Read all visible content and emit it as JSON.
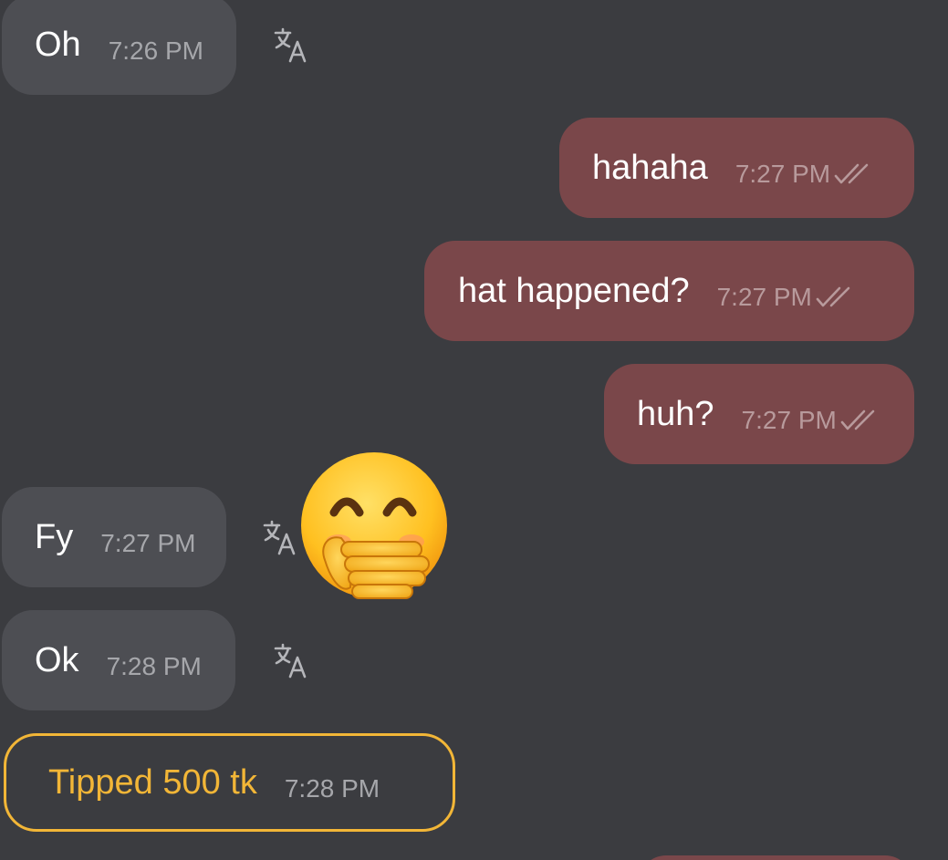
{
  "messages": [
    {
      "id": "m1",
      "direction": "incoming",
      "text": "Oh",
      "time": "7:26 PM",
      "translate_icon": "translate-icon"
    },
    {
      "id": "m2",
      "direction": "outgoing",
      "text": "hahaha",
      "time": "7:27 PM",
      "status_icon": "double-check-icon"
    },
    {
      "id": "m3",
      "direction": "outgoing",
      "text": "hat happened?",
      "time": "7:27 PM",
      "status_icon": "double-check-icon"
    },
    {
      "id": "m4",
      "direction": "outgoing",
      "text": "huh?",
      "time": "7:27 PM",
      "status_icon": "double-check-icon"
    },
    {
      "id": "m5",
      "direction": "incoming",
      "text": "Fy",
      "time": "7:27 PM",
      "translate_icon": "translate-icon"
    },
    {
      "id": "m6",
      "direction": "incoming",
      "text": "Ok",
      "time": "7:28 PM",
      "translate_icon": "translate-icon"
    }
  ],
  "tip": {
    "text": "Tipped 500 tk",
    "time": "7:28 PM"
  },
  "reaction": {
    "icon": "face-with-hand-over-mouth-emoji"
  },
  "colors": {
    "background": "#3b3c40",
    "incoming_bubble": "#4d4e53",
    "outgoing_bubble": "#7a474a",
    "tip_accent": "#f2b637"
  }
}
